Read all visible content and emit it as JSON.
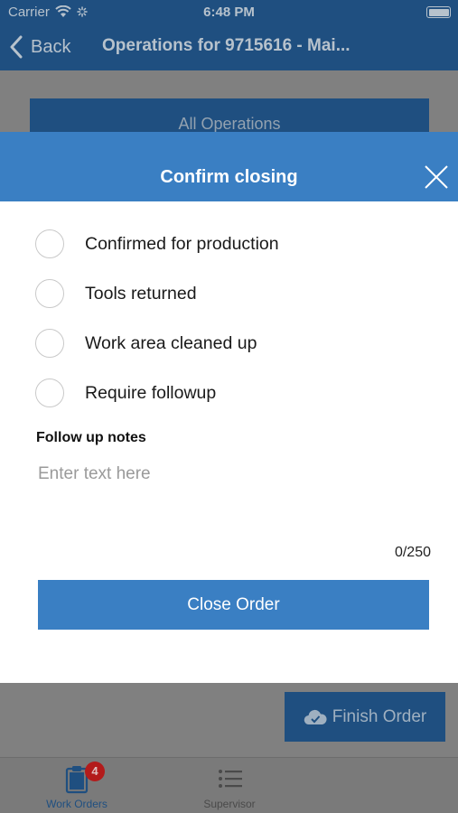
{
  "status_bar": {
    "carrier": "Carrier",
    "time": "6:48 PM"
  },
  "nav": {
    "back_label": "Back",
    "title": "Operations for 9715616 - Mai..."
  },
  "background": {
    "all_operations_label": "All Operations",
    "finish_order_label": "Finish Order"
  },
  "modal": {
    "title": "Confirm closing",
    "checklist": [
      {
        "label": "Confirmed for production",
        "checked": false
      },
      {
        "label": "Tools returned",
        "checked": false
      },
      {
        "label": "Work area cleaned up",
        "checked": false
      },
      {
        "label": "Require followup",
        "checked": false
      }
    ],
    "notes_label": "Follow up notes",
    "notes_placeholder": "Enter text here",
    "notes_value": "",
    "char_counter": "0/250",
    "close_order_label": "Close Order"
  },
  "tab_bar": {
    "tabs": [
      {
        "label": "Work Orders",
        "badge": "4",
        "active": true
      },
      {
        "label": "Supervisor",
        "active": false
      }
    ]
  },
  "colors": {
    "primary": "#3a7fc3",
    "nav_dimmed": "#1f4f80",
    "badge": "#b31b1b",
    "overlay": "#808080"
  },
  "icons": [
    "wifi-icon",
    "activity-icon",
    "battery-icon",
    "back-chevron-icon",
    "close-icon",
    "cloud-check-icon",
    "clipboard-icon",
    "list-icon"
  ]
}
